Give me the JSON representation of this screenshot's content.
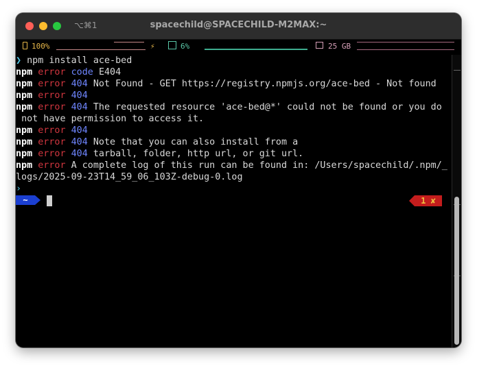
{
  "window": {
    "shortcut": "⌥⌘1",
    "title": "spacechild@SPACECHILD-M2MAX:~"
  },
  "status_bar": {
    "battery": "100%",
    "cpu": "6%",
    "memory": "25 GB"
  },
  "terminal": {
    "prompt_symbol": "❯",
    "command": "npm install ace-bed",
    "lines": [
      {
        "prefix": "npm",
        "level": "error",
        "code": "code",
        "text": "E404"
      },
      {
        "prefix": "npm",
        "level": "error",
        "code": "404",
        "text": "Not Found - GET https://registry.npmjs.org/ace-bed - Not found"
      },
      {
        "prefix": "npm",
        "level": "error",
        "code": "404",
        "text": ""
      },
      {
        "prefix": "npm",
        "level": "error",
        "code": "404",
        "text": " The requested resource 'ace-bed@*' could not be found or you do"
      },
      {
        "prefix": "",
        "level": "",
        "code": "",
        "text": "not have permission to access it."
      },
      {
        "prefix": "npm",
        "level": "error",
        "code": "404",
        "text": ""
      },
      {
        "prefix": "npm",
        "level": "error",
        "code": "404",
        "text": "Note that you can also install from a"
      },
      {
        "prefix": "npm",
        "level": "error",
        "code": "404",
        "text": "tarball, folder, http url, or git url."
      },
      {
        "prefix": "npm",
        "level": "error",
        "code": "",
        "text": "A complete log of this run can be found in: /Users/spacechild/.npm/_"
      },
      {
        "prefix": "",
        "level": "",
        "code": "",
        "text": "logs/2025-09-23T14_59_06_103Z-debug-0.log"
      }
    ],
    "prompt_dir": "~",
    "exit_status": "1 ✘"
  },
  "colors": {
    "error": "#d0363f",
    "code": "#6f86ff",
    "prompt_dir_bg": "#1b3fd1",
    "exit_status_bg": "#c41d1d"
  }
}
